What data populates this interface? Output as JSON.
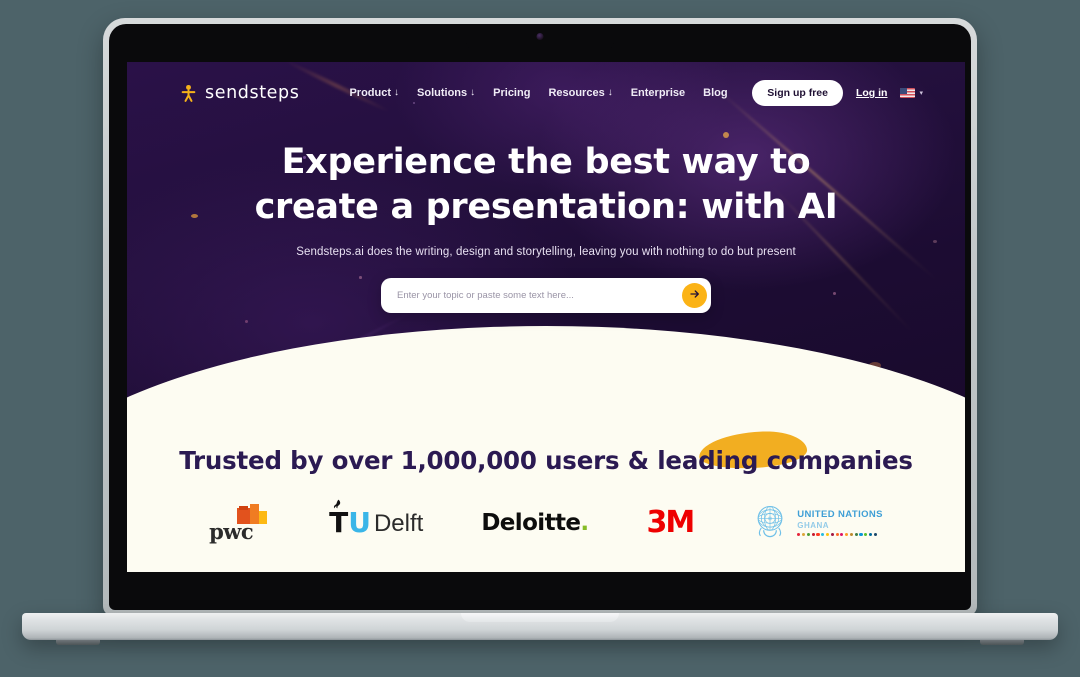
{
  "scene": {
    "background_color": "#4d6369",
    "device": "laptop"
  },
  "site": {
    "brand_name": "sendsteps",
    "brand_mark_icon": "person-figure-icon"
  },
  "nav": {
    "links": [
      {
        "label": "Product",
        "has_dropdown": true,
        "arrow": "↓"
      },
      {
        "label": "Solutions",
        "has_dropdown": true,
        "arrow": "↓"
      },
      {
        "label": "Pricing",
        "has_dropdown": false,
        "arrow": ""
      },
      {
        "label": "Resources",
        "has_dropdown": true,
        "arrow": "↓"
      },
      {
        "label": "Enterprise",
        "has_dropdown": false,
        "arrow": ""
      },
      {
        "label": "Blog",
        "has_dropdown": false,
        "arrow": ""
      }
    ],
    "signup_label": "Sign up free",
    "login_label": "Log in",
    "language_flag": "us-flag-icon",
    "language_caret": "▾"
  },
  "hero": {
    "headline_line1": "Experience the best way to",
    "headline_line2": "create a presentation: with AI",
    "subheadline": "Sendsteps.ai does the writing, design and storytelling, leaving you with nothing to do but present",
    "search_placeholder": "Enter your topic or paste some text here...",
    "search_value": "",
    "search_button_icon": "arrow-right-icon",
    "search_button_color": "#fbb316",
    "background_color": "#24103e"
  },
  "trusted": {
    "title": "Trusted by over 1,000,000 users & leading companies",
    "highlight_word": "companies",
    "highlight_color": "#f2ae21",
    "background_color": "#fdfcf2",
    "title_color": "#2b1a52",
    "logos": [
      {
        "name": "pwc",
        "text": "pwc"
      },
      {
        "name": "tu-delft",
        "text": "TUDelft"
      },
      {
        "name": "deloitte",
        "text": "Deloitte."
      },
      {
        "name": "3m",
        "text": "3M"
      },
      {
        "name": "united-nations-ghana",
        "line1": "UNITED NATIONS",
        "line2": "GHANA"
      }
    ]
  },
  "un_dot_colors": [
    "#e5243b",
    "#dda63a",
    "#4c9f38",
    "#c5192d",
    "#ff3a21",
    "#26bde2",
    "#fcc30b",
    "#a21942",
    "#fd6925",
    "#dd1367",
    "#fd9d24",
    "#bf8b2e",
    "#3f7e44",
    "#0a97d9",
    "#56c02b",
    "#00689d",
    "#19486a"
  ]
}
